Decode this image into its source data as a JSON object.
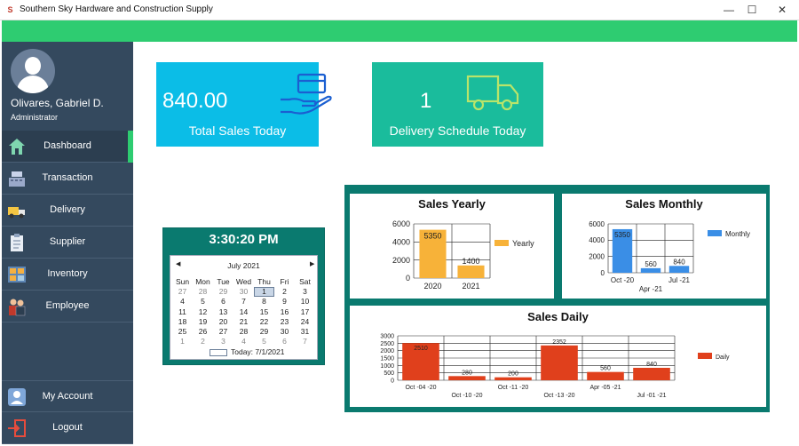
{
  "window": {
    "title": "Southern Sky Hardware and Construction Supply",
    "minimize": "—",
    "maximize": "☐",
    "close": "✕"
  },
  "user": {
    "name": "Olivares, Gabriel D.",
    "role": "Administrator"
  },
  "nav": {
    "dashboard": "Dashboard",
    "transaction": "Transaction",
    "delivery": "Delivery",
    "supplier": "Supplier",
    "inventory": "Inventory",
    "employee": "Employee",
    "my_account": "My Account",
    "logout": "Logout"
  },
  "cards": {
    "sales": {
      "value": "840.00",
      "label": "Total Sales Today"
    },
    "delivery": {
      "value": "1",
      "label": "Delivery Schedule Today"
    }
  },
  "clock": {
    "time": "3:30:20 PM"
  },
  "calendar": {
    "month_label": "July 2021",
    "prev": "◀",
    "next": "▶",
    "weekdays": [
      "Sun",
      "Mon",
      "Tue",
      "Wed",
      "Thu",
      "Fri",
      "Sat"
    ],
    "weeks": [
      [
        "27",
        "28",
        "29",
        "30",
        "1",
        "2",
        "3"
      ],
      [
        "4",
        "5",
        "6",
        "7",
        "8",
        "9",
        "10"
      ],
      [
        "11",
        "12",
        "13",
        "14",
        "15",
        "16",
        "17"
      ],
      [
        "18",
        "19",
        "20",
        "21",
        "22",
        "23",
        "24"
      ],
      [
        "25",
        "26",
        "27",
        "28",
        "29",
        "30",
        "31"
      ],
      [
        "1",
        "2",
        "3",
        "4",
        "5",
        "6",
        "7"
      ]
    ],
    "today_label": "Today: 7/1/2021"
  },
  "chart_data": [
    {
      "type": "bar",
      "title": "Sales Yearly",
      "categories": [
        "2020",
        "2021"
      ],
      "series": [
        {
          "name": "Yearly",
          "values": [
            5350,
            1400
          ]
        }
      ],
      "ylim": [
        0,
        6000
      ],
      "yticks": [
        "0",
        "2000",
        "4000",
        "6000"
      ],
      "data_labels": [
        "5350",
        "1400"
      ],
      "color": "#f7b239",
      "grid": true,
      "legend": "right"
    },
    {
      "type": "bar",
      "title": "Sales Monthly",
      "categories": [
        "Oct -20",
        "Apr -21",
        "Jul -21"
      ],
      "series": [
        {
          "name": "Monthly",
          "values": [
            5350,
            560,
            840
          ]
        }
      ],
      "ylim": [
        0,
        6000
      ],
      "yticks": [
        "0",
        "2000",
        "4000",
        "6000"
      ],
      "data_labels": [
        "5350",
        "560",
        "840"
      ],
      "color": "#3a8ee6",
      "grid": true,
      "legend": "right"
    },
    {
      "type": "bar",
      "title": "Sales Daily",
      "categories": [
        "Oct -04 -20",
        "Oct -10 -20",
        "Oct -11 -20",
        "Oct -13 -20",
        "Apr -05 -21",
        "Jul -01 -21"
      ],
      "series": [
        {
          "name": "Daily",
          "values": [
            2510,
            280,
            200,
            2352,
            560,
            840
          ]
        }
      ],
      "ylim": [
        0,
        3000
      ],
      "yticks": [
        "0",
        "500",
        "1000",
        "1500",
        "2000",
        "2500",
        "3000"
      ],
      "data_labels": [
        "2510",
        "280",
        "200",
        "2352",
        "560",
        "840"
      ],
      "color": "#e0401c",
      "grid": true,
      "legend": "right"
    }
  ]
}
